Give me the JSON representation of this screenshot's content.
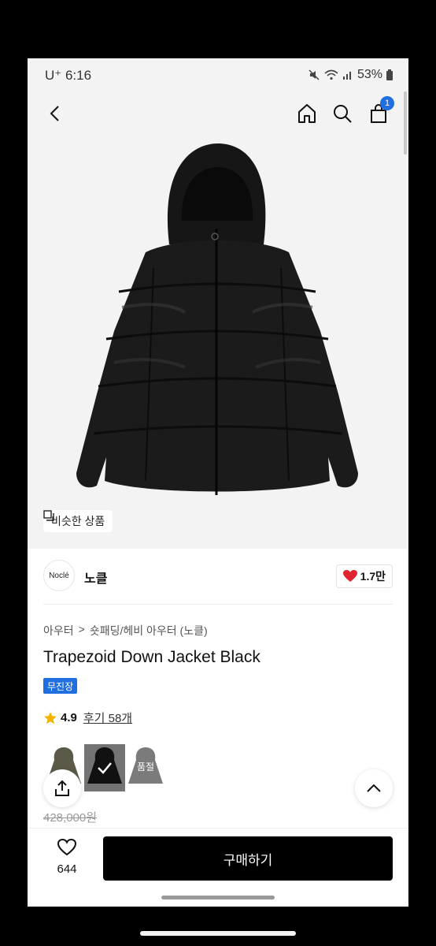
{
  "status_bar": {
    "time": "U⁺ 6:16",
    "battery": "53%"
  },
  "header": {
    "cart_count": "1"
  },
  "similar_products_label": "비슷한 상품",
  "brand": {
    "logo_text": "Noclé",
    "name": "노클",
    "likes": "1.7만"
  },
  "breadcrumb": {
    "level1": "아우터",
    "separator": ">",
    "level2": "숏패딩/헤비 아우터 (노클)"
  },
  "product": {
    "title": "Trapezoid Down Jacket Black",
    "badge": "무진장",
    "rating": "4.9",
    "reviews": "후기 58개",
    "original_price": "428,000원"
  },
  "options": [
    {
      "name": "khaki",
      "selected": false,
      "sold_out": false
    },
    {
      "name": "black",
      "selected": true,
      "sold_out": false
    },
    {
      "name": "grey",
      "selected": false,
      "sold_out": true,
      "label": "품절"
    }
  ],
  "bottom_bar": {
    "wish_count": "644",
    "buy_label": "구매하기"
  },
  "colors": {
    "accent": "#1f6fe0",
    "heart": "#e0242f",
    "star": "#f4b400",
    "buy_button": "#000000"
  }
}
